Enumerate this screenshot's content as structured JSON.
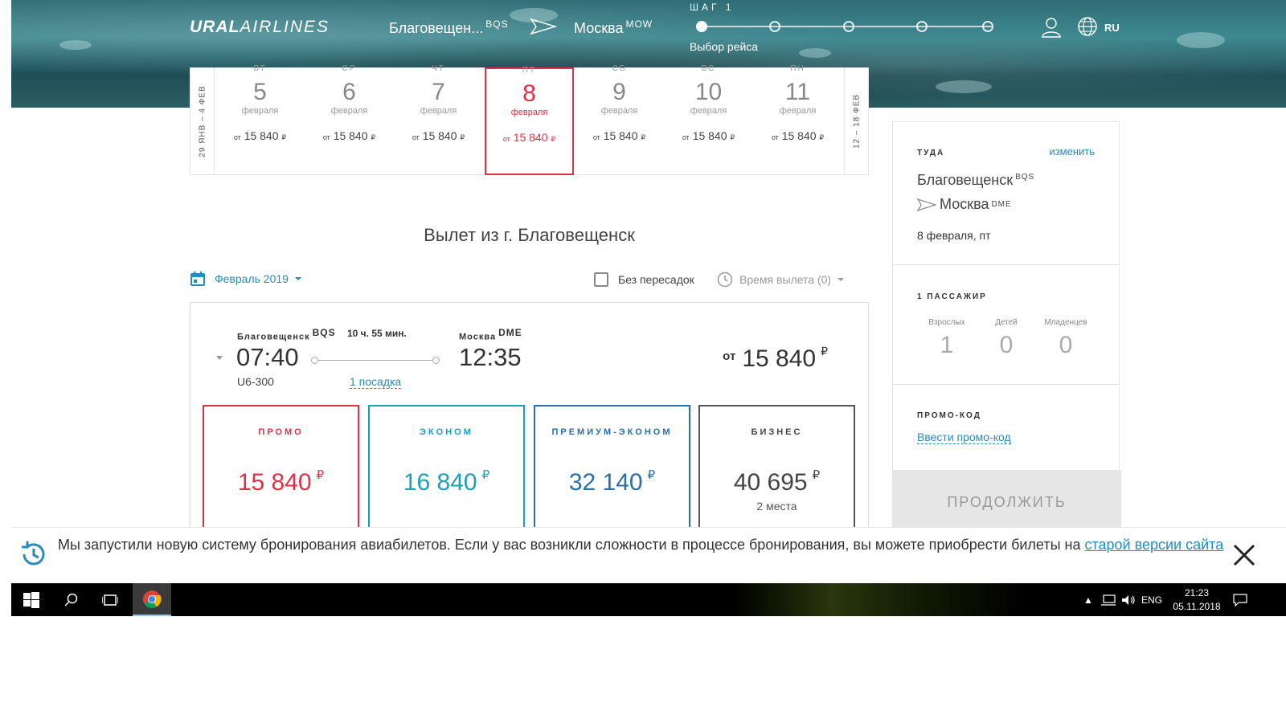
{
  "header": {
    "logo_bold": "URAL",
    "logo_thin": "AIRLINES",
    "from_city": "Благовещен...",
    "from_code": "BQS",
    "to_city": "Москва",
    "to_code": "MOW",
    "step_label": "ШАГ 1",
    "step_name": "Выбор рейса",
    "lang": "RU"
  },
  "date_strip": {
    "prev_range": "29 ЯНВ – 4 ФЕВ",
    "next_range": "12 – 18 ФЕВ",
    "days": [
      {
        "dow": "ВТ",
        "num": "5",
        "month": "февраля",
        "from": "от",
        "price": "15 840",
        "cur": "₽"
      },
      {
        "dow": "СР",
        "num": "6",
        "month": "февраля",
        "from": "от",
        "price": "15 840",
        "cur": "₽"
      },
      {
        "dow": "ЧТ",
        "num": "7",
        "month": "февраля",
        "from": "от",
        "price": "15 840",
        "cur": "₽"
      },
      {
        "dow": "ПТ",
        "num": "8",
        "month": "февраля",
        "from": "от",
        "price": "15 840",
        "cur": "₽"
      },
      {
        "dow": "СБ",
        "num": "9",
        "month": "февраля",
        "from": "от",
        "price": "15 840",
        "cur": "₽"
      },
      {
        "dow": "ВС",
        "num": "10",
        "month": "февраля",
        "from": "от",
        "price": "15 840",
        "cur": "₽"
      },
      {
        "dow": "ПН",
        "num": "11",
        "month": "февраля",
        "from": "от",
        "price": "15 840",
        "cur": "₽"
      }
    ]
  },
  "main": {
    "title": "Вылет из г. Благовещенск",
    "month_filter": "Февраль 2019",
    "nonstop_label": "Без пересадок",
    "time_filter": "Время вылета (0)"
  },
  "flight": {
    "dep_city": "Благовещенск",
    "dep_code": "BQS",
    "dep_time": "07:40",
    "flight_no": "U6-300",
    "duration": "10 ч. 55 мин.",
    "stops": "1 посадка",
    "arr_city": "Москва",
    "arr_code": "DME",
    "arr_time": "12:35",
    "price_from": "от",
    "price": "15 840",
    "currency": "₽",
    "fares": [
      {
        "name": "ПРОМО",
        "price": "15 840",
        "cur": "₽",
        "seats": ""
      },
      {
        "name": "ЭКОНОМ",
        "price": "16 840",
        "cur": "₽",
        "seats": ""
      },
      {
        "name": "ПРЕМИУМ-ЭКОНОМ",
        "price": "32 140",
        "cur": "₽",
        "seats": ""
      },
      {
        "name": "БИЗНЕС",
        "price": "40 695",
        "cur": "₽",
        "seats": "2 места"
      }
    ]
  },
  "sidebar": {
    "direction_label": "ТУДА",
    "change_label": "изменить",
    "from_city": "Благовещенск",
    "from_code": "BQS",
    "to_city": "Москва",
    "to_code": "DME",
    "date": "8 февраля, пт",
    "passengers_label": "1 ПАССАЖИР",
    "adults_label": "Взрослых",
    "adults": "1",
    "children_label": "Детей",
    "children": "0",
    "infants_label": "Младенцев",
    "infants": "0",
    "promo_label": "ПРОМО-КОД",
    "promo_link": "Ввести промо-код",
    "continue_label": "ПРОДОЛЖИТЬ"
  },
  "notice": {
    "text": "Мы запустили новую систему бронирования авиабилетов. Если у вас возникли сложности в процессе бронирования, вы можете приобрести билеты на ",
    "link": "старой версии сайта"
  },
  "taskbar": {
    "lang": "ENG",
    "time": "21:23",
    "date": "05.11.2018"
  },
  "colors": {
    "accent_red": "#e03146",
    "accent_blue": "#2a8ab8",
    "econom": "#1ba1b7",
    "premium": "#2a6fa8"
  }
}
